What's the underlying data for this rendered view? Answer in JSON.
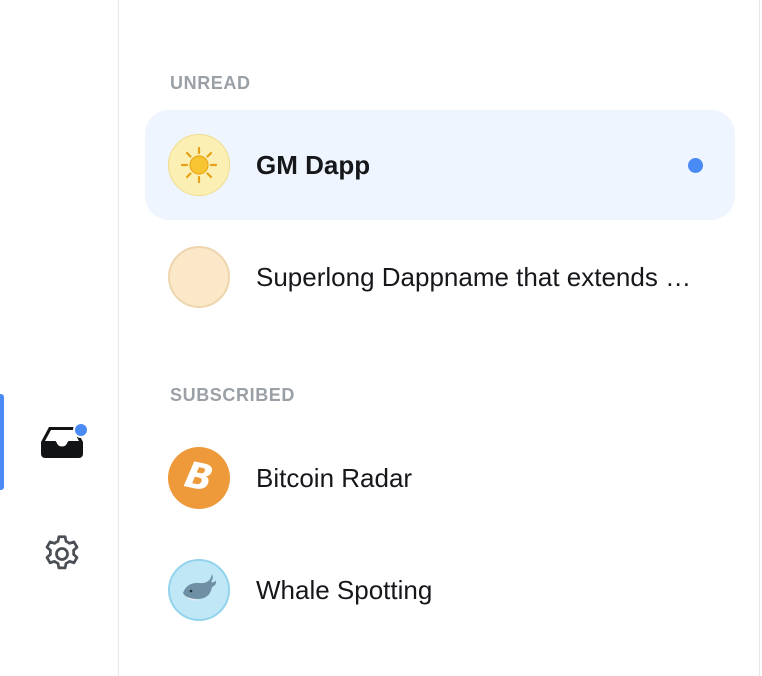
{
  "sidebar": {
    "items": [
      {
        "name": "inbox",
        "icon": "inbox-icon",
        "active": true,
        "has_badge": true
      },
      {
        "name": "settings",
        "icon": "gear-icon",
        "active": false
      }
    ],
    "accent_color": "#4a8af4"
  },
  "sections": {
    "unread": {
      "heading": "UNREAD",
      "items": [
        {
          "label": "GM Dapp",
          "icon": "sun-icon",
          "selected": true,
          "unread": true
        },
        {
          "label": "Superlong Dappname that extends beyond the width",
          "icon": "blank-avatar",
          "selected": false,
          "unread": false
        }
      ]
    },
    "subscribed": {
      "heading": "SUBSCRIBED",
      "items": [
        {
          "label": "Bitcoin Radar",
          "icon": "bitcoin-icon"
        },
        {
          "label": "Whale Spotting",
          "icon": "whale-icon"
        }
      ]
    }
  },
  "colors": {
    "selected_row_bg": "#eef5fe",
    "heading": "#9aa0a6",
    "text": "#15171a"
  }
}
